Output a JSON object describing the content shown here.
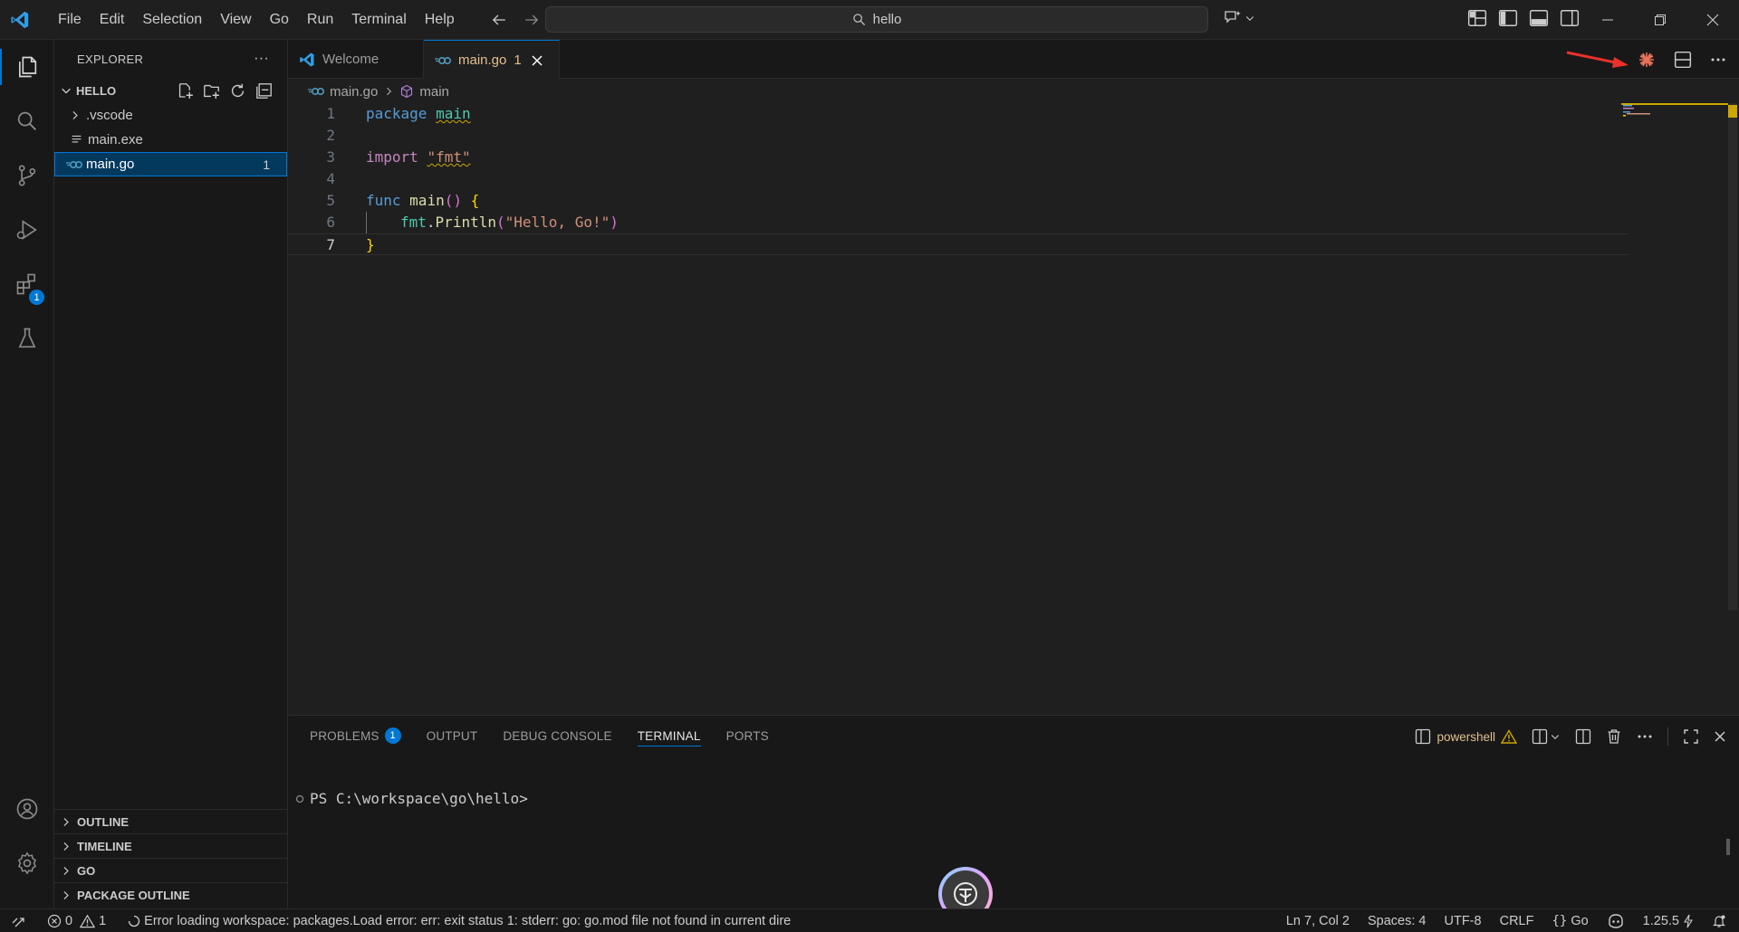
{
  "titlebar": {
    "menu": [
      "File",
      "Edit",
      "Selection",
      "View",
      "Go",
      "Run",
      "Terminal",
      "Help"
    ],
    "search_text": "hello"
  },
  "activitybar": {
    "items": [
      "explorer-icon",
      "search-icon",
      "source-control-icon",
      "run-debug-icon",
      "extensions-icon",
      "testing-icon"
    ],
    "extensions_badge": "1",
    "bottom": [
      "accounts-icon",
      "settings-gear-icon"
    ]
  },
  "sidebar": {
    "title": "EXPLORER",
    "more": "···",
    "folder": "HELLO",
    "items": [
      {
        "label": ".vscode",
        "type": "folder"
      },
      {
        "label": "main.exe",
        "type": "file"
      },
      {
        "label": "main.go",
        "type": "go",
        "count": "1"
      }
    ],
    "sections": [
      "OUTLINE",
      "TIMELINE",
      "GO",
      "PACKAGE OUTLINE"
    ]
  },
  "tabs": [
    {
      "label": "Welcome"
    },
    {
      "label": "main.go",
      "count": "1"
    }
  ],
  "breadcrumb": {
    "file": "main.go",
    "symbol": "main"
  },
  "editor": {
    "line_numbers": [
      "1",
      "2",
      "3",
      "4",
      "5",
      "6",
      "7"
    ],
    "lines": {
      "l1_kw": "package",
      "l1_name": "main",
      "l3_kw": "import",
      "l3_str": "\"fmt\"",
      "l5_kw": "func",
      "l5_fn": "main",
      "l5_paren": "()",
      "l5_brace": "{",
      "l6_pkg": "fmt",
      "l6_dot": ".",
      "l6_fn": "Println",
      "l6_open": "(",
      "l6_str": "\"Hello, Go!\"",
      "l6_close": ")",
      "l7_brace": "}"
    }
  },
  "panel": {
    "tabs": [
      "PROBLEMS",
      "OUTPUT",
      "DEBUG CONSOLE",
      "TERMINAL",
      "PORTS"
    ],
    "problems_count": "1",
    "terminal_name": "powershell",
    "prompt": "PS C:\\workspace\\go\\hello>"
  },
  "statusbar": {
    "errors": "0",
    "warnings": "1",
    "message": "Error loading workspace: packages.Load error: err: exit status 1: stderr: go: go.mod file not found in current dire",
    "position": "Ln 7, Col 2",
    "spaces": "Spaces: 4",
    "encoding": "UTF-8",
    "eol": "CRLF",
    "language": "Go",
    "go_version": "1.25.5"
  },
  "colors": {
    "accent": "#0078d4",
    "go_blue": "#519aba",
    "warning": "#cca700",
    "modified_tab": "#e2c08d",
    "annotation_arrow": "#e8322b"
  }
}
